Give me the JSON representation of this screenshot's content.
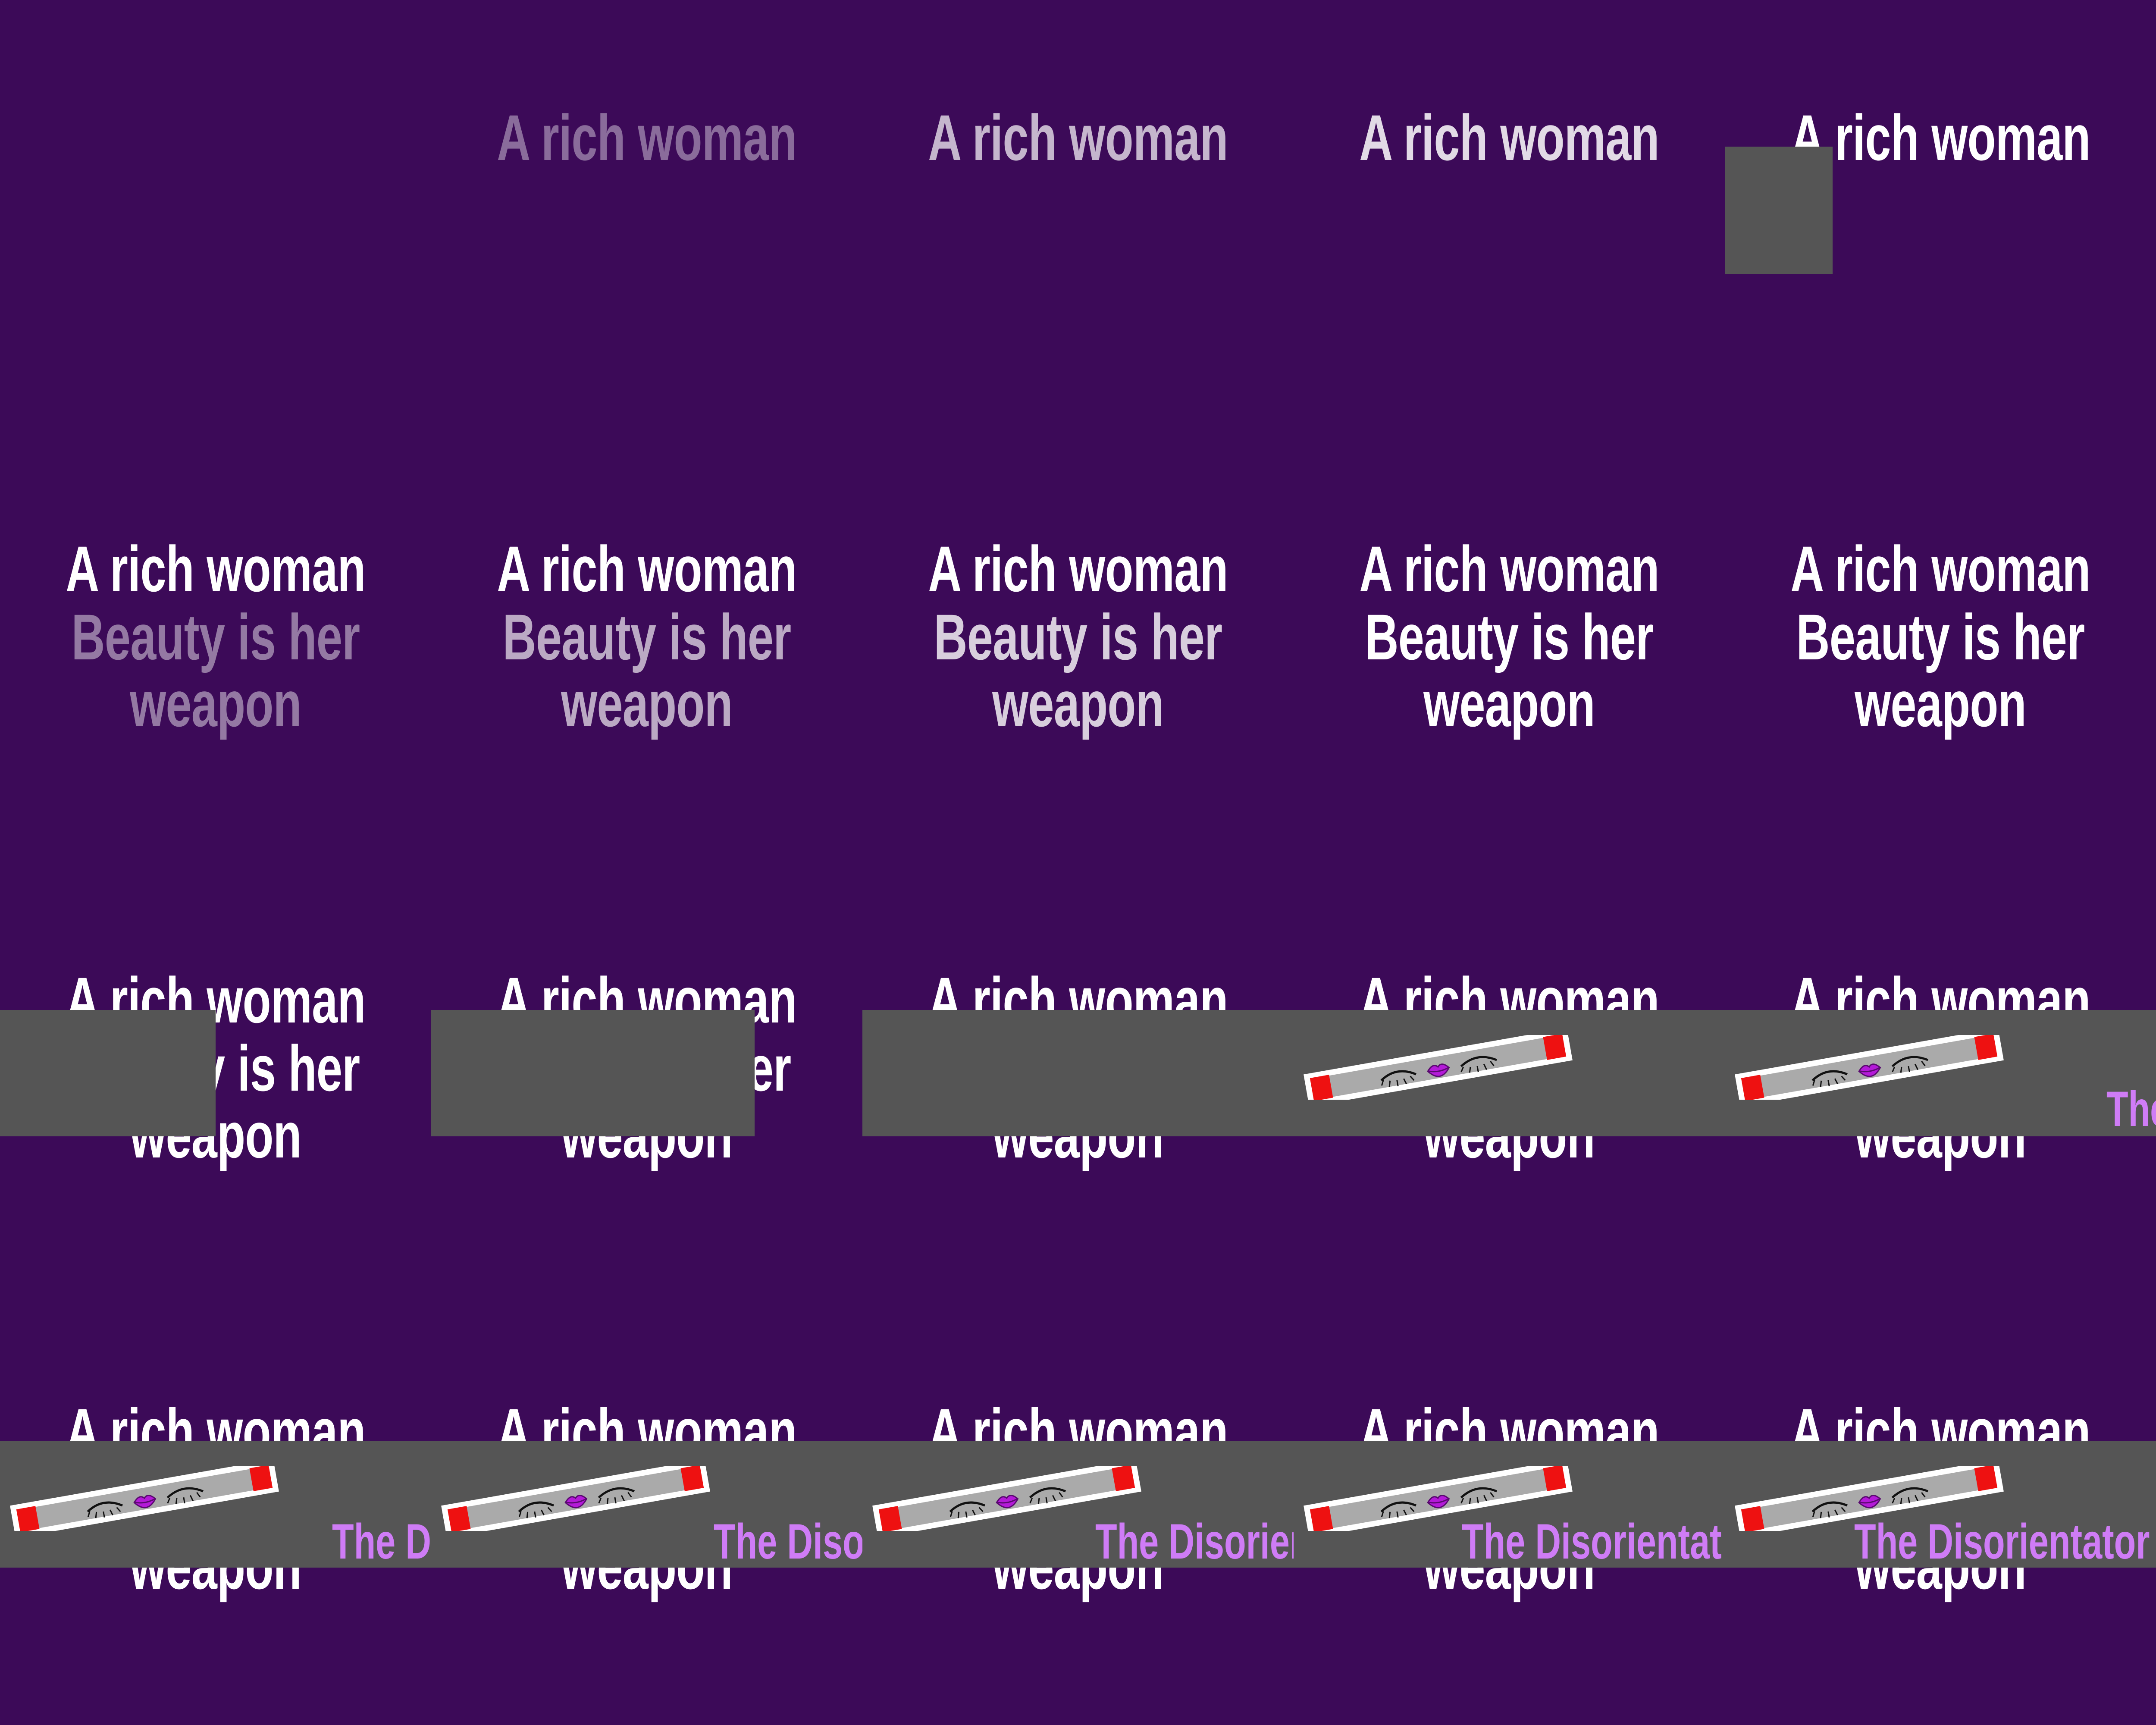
{
  "background": "#3c0a58",
  "bar_color": "#555555",
  "brand_color": "#cf7cf6",
  "text_color": "#ffffff",
  "headline": "A rich woman",
  "subline_1": "Beauty is her",
  "subline_2": "weapon",
  "brand_text": "The Disorientator",
  "brand_visible": [
    "",
    "",
    "",
    "",
    "",
    "",
    "",
    "",
    "",
    "",
    "",
    "",
    "",
    "",
    "The",
    "The Di",
    "The Disor",
    "The Disorien",
    "The Disorientat",
    "The Disorientator"
  ],
  "frames": [
    {
      "line1": 0,
      "line2": 0,
      "line3": 0
    },
    {
      "line1": 0.4,
      "line2": 0,
      "line3": 0
    },
    {
      "line1": 0.7,
      "line2": 0,
      "line3": 0
    },
    {
      "line1": 0.85,
      "line2": 0,
      "line3": 0
    },
    {
      "line1": 1,
      "line2": 0,
      "line3": 0
    },
    {
      "line1": 1,
      "line2": 0.45,
      "line3": 0.45
    },
    {
      "line1": 1,
      "line2": 0.65,
      "line3": 0.65
    },
    {
      "line1": 1,
      "line2": 0.8,
      "line3": 0.8
    },
    {
      "line1": 1,
      "line2": 1,
      "line3": 1
    },
    {
      "line1": 1,
      "line2": 1,
      "line3": 1
    },
    {
      "line1": 1,
      "line2": 1,
      "line3": 1
    },
    {
      "line1": 1,
      "line2": 1,
      "line3": 1
    },
    {
      "line1": 1,
      "line2": 1,
      "line3": 1
    },
    {
      "line1": 1,
      "line2": 1,
      "line3": 1
    },
    {
      "line1": 1,
      "line2": 1,
      "line3": 1
    },
    {
      "line1": 1,
      "line2": 1,
      "line3": 1
    },
    {
      "line1": 1,
      "line2": 1,
      "line3": 1
    },
    {
      "line1": 1,
      "line2": 1,
      "line3": 1
    },
    {
      "line1": 1,
      "line2": 1,
      "line3": 1
    },
    {
      "line1": 1,
      "line2": 1,
      "line3": 1
    }
  ]
}
